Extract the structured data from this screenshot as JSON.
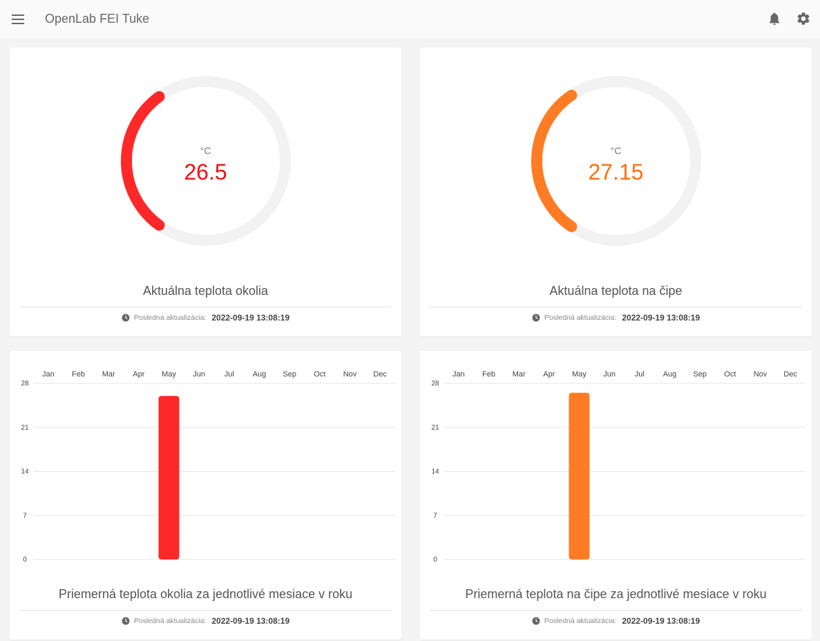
{
  "app": {
    "title": "OpenLab FEI Tuke"
  },
  "icons": {
    "menu": "menu-icon",
    "notifications": "bell-icon",
    "settings": "gear-icon",
    "clock": "clock-icon"
  },
  "colors": {
    "ambient": "#ff2828",
    "chip": "#ff7c24",
    "track": "#f2f2f2"
  },
  "gauges": [
    {
      "unit": "°C",
      "value": "26.5",
      "title": "Aktuálna teplota okolia",
      "footer_label": "Posledná aktualizácia:",
      "footer_time": "2022-09-19 13:08:19"
    },
    {
      "unit": "°C",
      "value": "27.15",
      "title": "Aktuálna teplota na čipe",
      "footer_label": "Posledná aktualizácia:",
      "footer_time": "2022-09-19 13:08:19"
    }
  ],
  "charts": [
    {
      "title": "Priemerná teplota okolia za jednotlivé mesiace v roku",
      "footer_label": "Posledná aktualizácia:",
      "footer_time": "2022-09-19 13:08:19"
    },
    {
      "title": "Priemerná teplota na čipe za jednotlivé mesiace v roku",
      "footer_label": "Posledná aktualizácia:",
      "footer_time": "2022-09-19 13:08:19"
    }
  ],
  "chart_data": [
    {
      "type": "bar",
      "categories": [
        "Jan",
        "Feb",
        "Mar",
        "Apr",
        "May",
        "Jun",
        "Jul",
        "Aug",
        "Sep",
        "Oct",
        "Nov",
        "Dec"
      ],
      "values": [
        null,
        null,
        null,
        null,
        26,
        null,
        null,
        null,
        null,
        null,
        null,
        null
      ],
      "yticks": [
        0,
        7,
        14,
        21,
        28
      ],
      "ylim": [
        0,
        28
      ],
      "xaxis_position": "top",
      "grid": true,
      "color": "#ff2828"
    },
    {
      "type": "bar",
      "categories": [
        "Jan",
        "Feb",
        "Mar",
        "Apr",
        "May",
        "Jun",
        "Jul",
        "Aug",
        "Sep",
        "Oct",
        "Nov",
        "Dec"
      ],
      "values": [
        null,
        null,
        null,
        null,
        26.5,
        null,
        null,
        null,
        null,
        null,
        null,
        null
      ],
      "yticks": [
        0,
        7,
        14,
        21,
        28
      ],
      "ylim": [
        0,
        28
      ],
      "xaxis_position": "top",
      "grid": true,
      "color": "#ff7c24"
    }
  ]
}
